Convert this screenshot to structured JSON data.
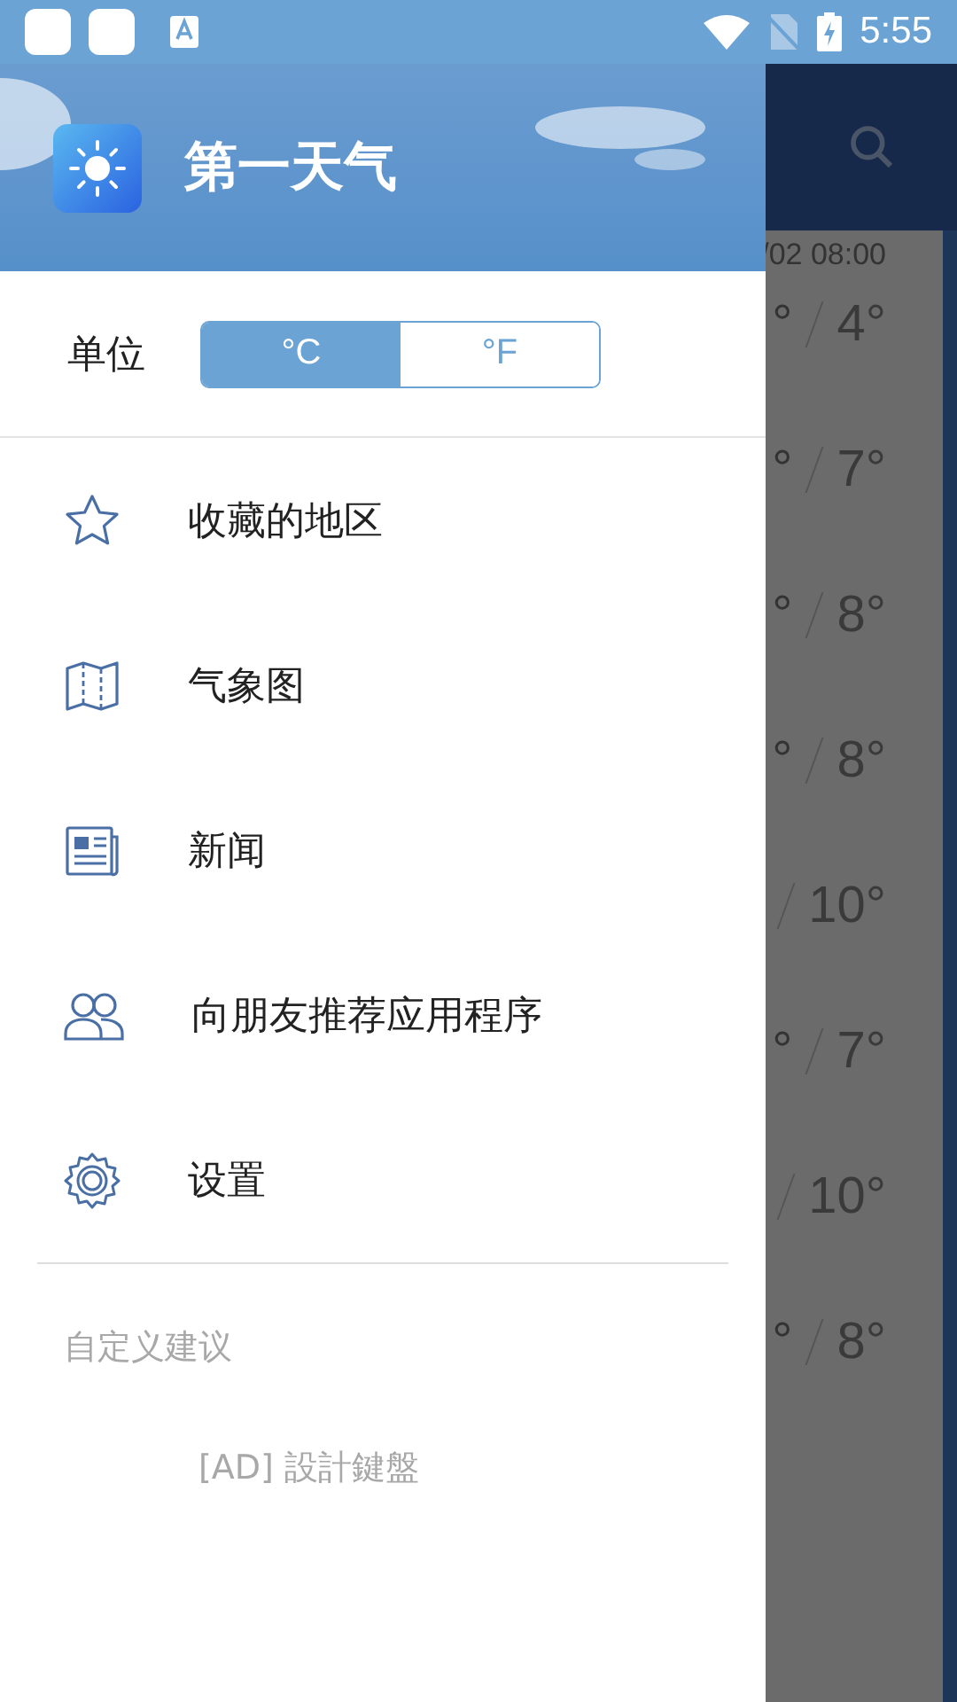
{
  "status_bar": {
    "time": "5:55"
  },
  "background": {
    "date": "/02 08:00",
    "rows": [
      {
        "low": "°",
        "high": "4°"
      },
      {
        "low": "°",
        "high": "7°"
      },
      {
        "low": "°",
        "high": "8°"
      },
      {
        "low": "°",
        "high": "8°"
      },
      {
        "low": "",
        "high": "10°"
      },
      {
        "low": "°",
        "high": "7°"
      },
      {
        "low": "",
        "high": "10°"
      },
      {
        "low": "°",
        "high": "8°"
      }
    ]
  },
  "drawer": {
    "title": "第一天气",
    "unit": {
      "label": "单位",
      "options": [
        {
          "label": "°C",
          "selected": true
        },
        {
          "label": "°F",
          "selected": false
        }
      ]
    },
    "menu": [
      {
        "kind": "star",
        "label": "收藏的地区"
      },
      {
        "kind": "map",
        "label": "气象图"
      },
      {
        "kind": "news",
        "label": "新闻"
      },
      {
        "kind": "people",
        "label": "向朋友推荐应用程序"
      },
      {
        "kind": "gear",
        "label": "设置"
      }
    ],
    "faded": [
      {
        "label": "自定义建议"
      },
      {
        "label": "[AD] 設計鍵盤"
      }
    ]
  }
}
